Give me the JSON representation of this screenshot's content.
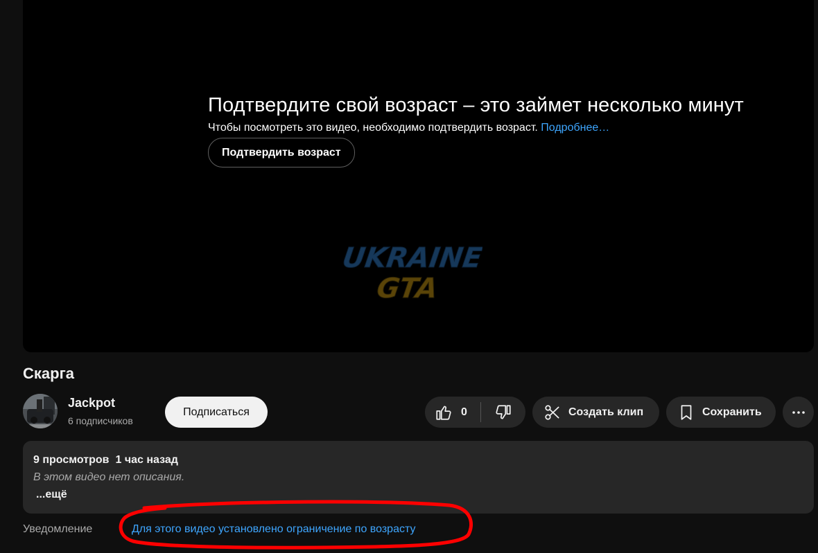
{
  "player": {
    "age_gate": {
      "title": "Подтвердите свой возраст – это займет несколько минут",
      "subtitle": "Чтобы посмотреть это видео, необходимо подтвердить возраст.",
      "learn_more": "Подробнее…",
      "verify_label": "Подтвердить возраст"
    },
    "watermark": {
      "line1": "UKRAINE",
      "line2": "GTA"
    }
  },
  "video": {
    "title": "Скарга"
  },
  "channel": {
    "name": "Jackpot",
    "subscribers": "6 подписчиков",
    "subscribe_label": "Подписаться"
  },
  "actions": {
    "like_count": "0",
    "clip_label": "Создать клип",
    "save_label": "Сохранить",
    "icons": {
      "like": "thumbs-up-icon",
      "dislike": "thumbs-down-icon",
      "clip": "scissors-icon",
      "save": "bookmark-icon",
      "more": "more-horizontal-icon"
    }
  },
  "description": {
    "views": "9 просмотров",
    "time": "1 час назад",
    "empty_text": "В этом видео нет описания.",
    "more_label": "...ещё"
  },
  "notice": {
    "label": "Уведомление",
    "link": "Для этого видео установлено ограничение по возрасту"
  },
  "colors": {
    "background": "#0f0f0f",
    "surface": "#272727",
    "link": "#3ea6ff",
    "annotation": "#ff0000"
  }
}
